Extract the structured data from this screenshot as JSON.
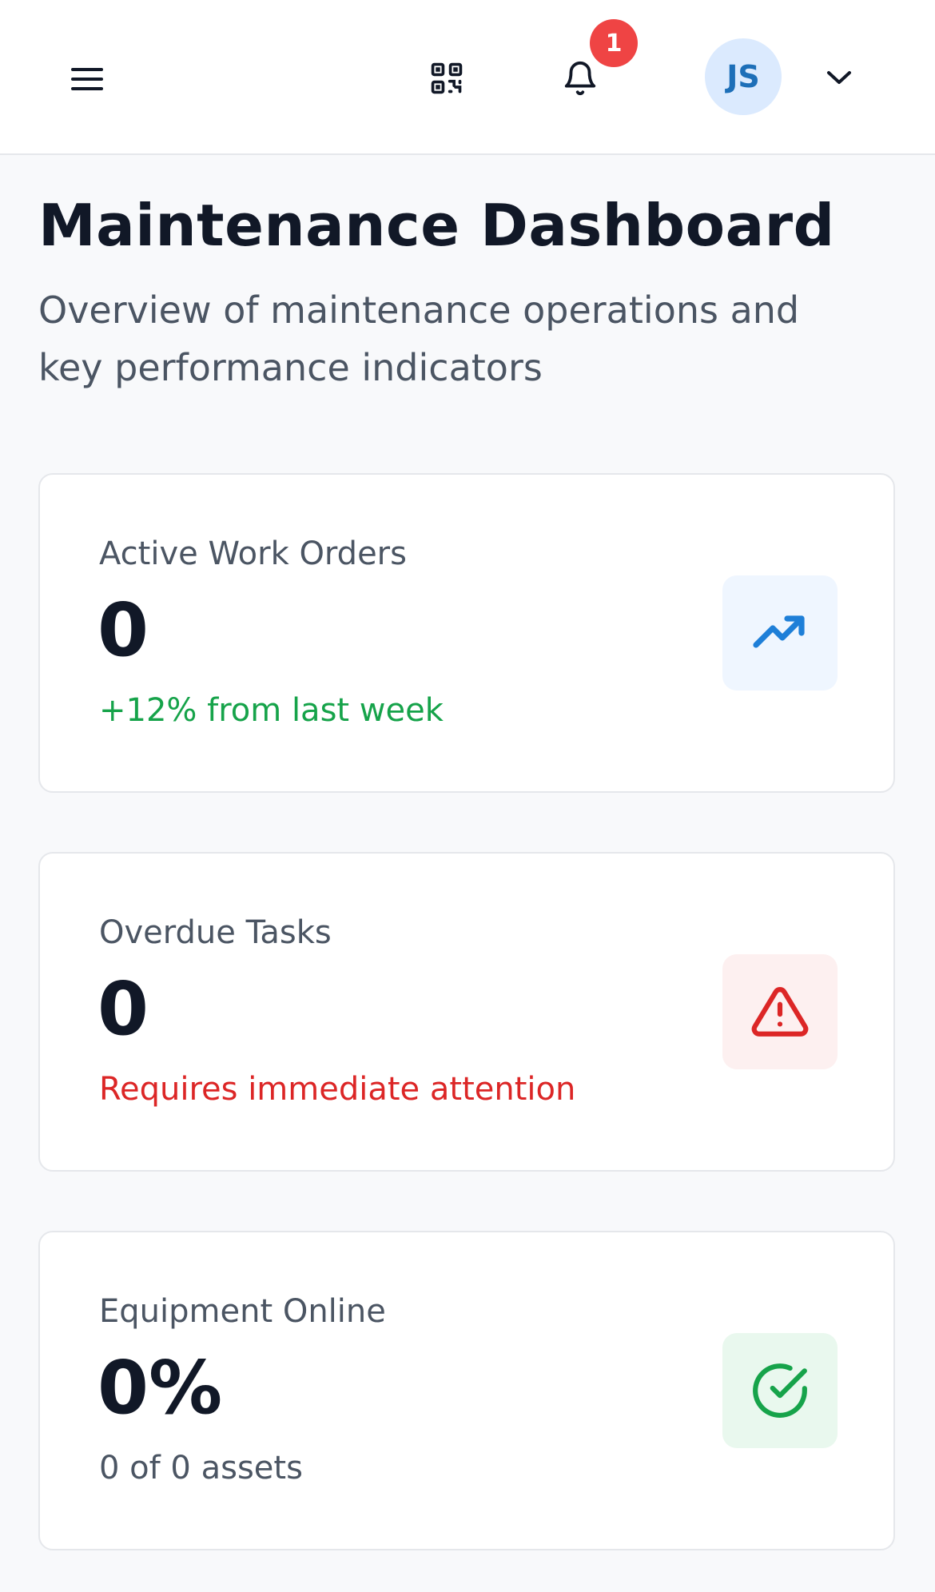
{
  "header": {
    "notification_count": "1",
    "user_initials": "JS",
    "icons": [
      "menu-icon",
      "qr-code-icon",
      "bell-icon",
      "chevron-down-icon"
    ]
  },
  "page": {
    "title": "Maintenance Dashboard",
    "subtitle": "Overview of maintenance operations and key performance indicators"
  },
  "cards": [
    {
      "label": "Active Work Orders",
      "value": "0",
      "note": "+12% from last week",
      "note_color": "#16a34a",
      "icon": "trending-up-icon",
      "icon_color": "#1e7fd8",
      "icon_bg": "#eff6ff"
    },
    {
      "label": "Overdue Tasks",
      "value": "0",
      "note": "Requires immediate attention",
      "note_color": "#dc2626",
      "icon": "alert-triangle-icon",
      "icon_color": "#dc2626",
      "icon_bg": "#fdf0f0"
    },
    {
      "label": "Equipment Online",
      "value": "0%",
      "note": "0 of 0 assets",
      "note_color": "#4b5563",
      "icon": "check-circle-icon",
      "icon_color": "#16a34a",
      "icon_bg": "#e9f8ee"
    }
  ]
}
